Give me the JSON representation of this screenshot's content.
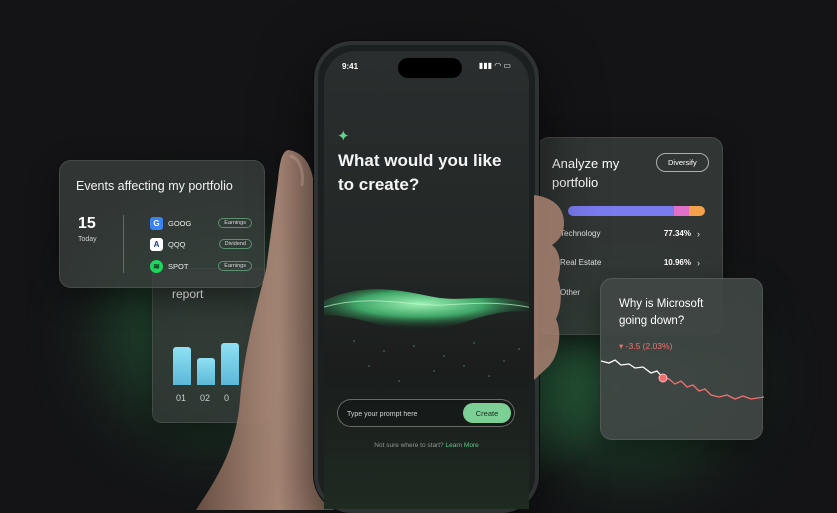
{
  "events_card": {
    "title": "Events affecting my portfolio",
    "day_number": "15",
    "day_label": "Today",
    "events": [
      {
        "ticker": "GOOG",
        "tag": "Earnings",
        "logo_color": "#3b82f6",
        "logo_glyph": "G",
        "icon": "google-icon"
      },
      {
        "ticker": "QQQ",
        "tag": "Dividend",
        "logo_color": "#ffffff",
        "logo_glyph": "A",
        "icon": "invesco-icon"
      },
      {
        "ticker": "SPOT",
        "tag": "Earnings",
        "logo_color": "#1ed760",
        "logo_glyph": "≋",
        "icon": "spotify-icon"
      }
    ]
  },
  "report_card": {
    "title": "report",
    "bars": [
      {
        "label": "01",
        "value": 0.62
      },
      {
        "label": "02",
        "value": 0.43
      },
      {
        "label": "0",
        "value": 0.68
      }
    ]
  },
  "phone": {
    "time": "9:41",
    "status_icons": "signal-wifi-battery",
    "status_glyphs": "▮▮▮ ◠ ▭",
    "sparkle_icon": "sparkle-icon",
    "headline": "What would you like to create?",
    "prompt_placeholder": "Type your prompt here",
    "create_label": "Create",
    "hint_text": "Not sure where to start?",
    "hint_link": "Learn More"
  },
  "analyze_card": {
    "title": "Analyze my portfolio",
    "diversify_label": "Diversify",
    "allocation": [
      {
        "color": "#7b7bf0",
        "value": 0.7734
      },
      {
        "color": "#e070c8",
        "value": 0.1096
      },
      {
        "color": "#f5a04a",
        "value": 0.117
      }
    ],
    "rows": [
      {
        "label": "Technology",
        "pct": "77.34%"
      },
      {
        "label": "Real Estate",
        "pct": "10.96%"
      },
      {
        "label": "Other",
        "pct": ""
      }
    ]
  },
  "msft_card": {
    "title": "Why is Microsoft going down?",
    "change": "-3.5 (2.03%)",
    "line_color": "#f07070"
  },
  "colors": {
    "accent_green": "#7ccf95",
    "background": "#141416"
  }
}
